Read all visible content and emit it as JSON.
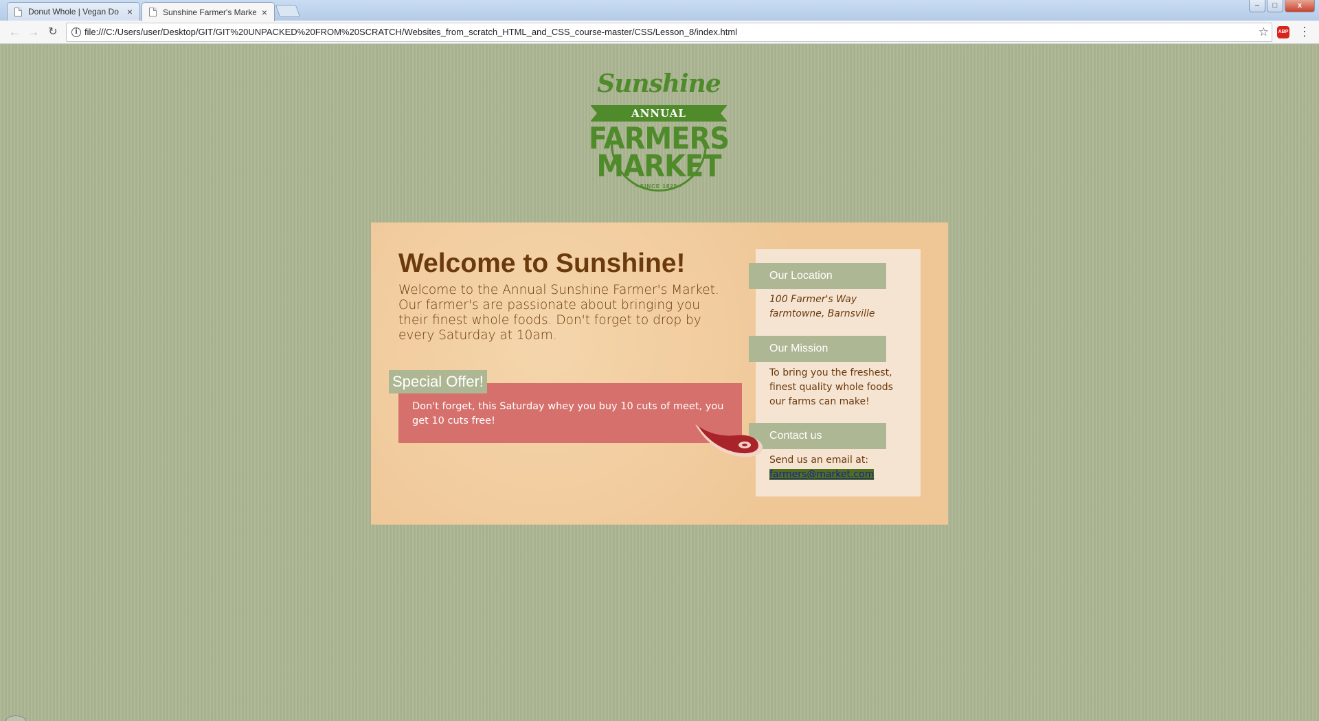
{
  "browser": {
    "tabs": [
      {
        "title": "Donut Whole | Vegan Do",
        "active": false
      },
      {
        "title": "Sunshine Farmer's Marke",
        "active": true
      }
    ],
    "close_glyph": "×",
    "url": "file:///C:/Users/user/Desktop/GIT/GIT%20UNPACKED%20FROM%20SCRATCH/Websites_from_scratch_HTML_and_CSS_course-master/CSS/Lesson_8/index.html",
    "nav": {
      "back": "←",
      "forward": "→",
      "reload": "↻"
    },
    "star": "☆",
    "adblock": "ABP",
    "menu": "⋮",
    "window": {
      "minimize": "–",
      "maximize": "□",
      "close": "x"
    }
  },
  "logo": {
    "script": "Sunshine",
    "ribbon": "ANNUAL",
    "line1": "FARMERS",
    "line2": "MARKET",
    "since": "· SINCE 1825 ·"
  },
  "welcome": {
    "title": "Welcome to Sunshine!",
    "text": "Welcome to the Annual Sunshine Farmer's Market. Our farmer's are passionate about bringing you their finest whole foods. Don't forget to drop by every Saturday at 10am."
  },
  "offer": {
    "label": "Special Offer!",
    "text": "Don't forget, this Saturday whey you buy 10 cuts of meet, you get 10 cuts free!"
  },
  "sidebar": {
    "location": {
      "heading": "Our Location",
      "line1": "100 Farmer's Way",
      "line2": "farmtowne, Barnsville"
    },
    "mission": {
      "heading": "Our Mission",
      "text": "To bring you the freshest, finest quality whole foods our farms can make!"
    },
    "contact": {
      "heading": "Contact us",
      "text": "Send us an email at:",
      "email": "farmers@market.com"
    }
  },
  "colors": {
    "background": "#adb794",
    "card": "#efc797",
    "offer": "#d6706c",
    "sidebar": "#f6e4d3",
    "brand_green": "#4f8a2b",
    "text_brown": "#6b3a0c"
  }
}
